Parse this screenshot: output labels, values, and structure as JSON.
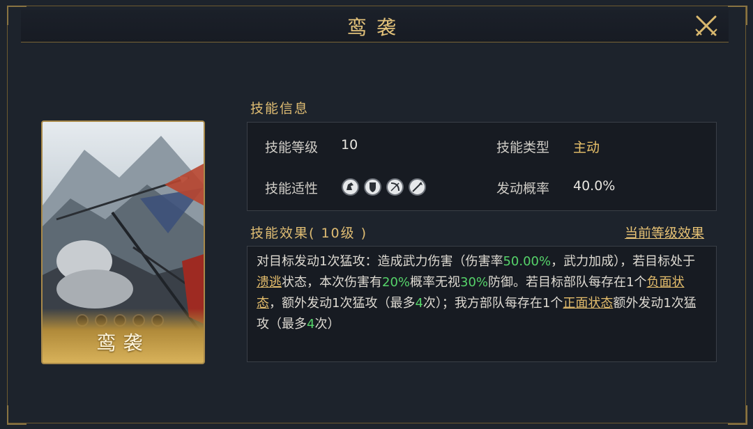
{
  "header": {
    "title": "鸾袭"
  },
  "card": {
    "name": "鸾袭",
    "level_dots": 5
  },
  "info": {
    "section_title": "技能信息",
    "level_label": "技能等级",
    "level_value": "10",
    "type_label": "技能类型",
    "type_value": "主动",
    "affinity_label": "技能适性",
    "affinity_icons": [
      "cavalry-icon",
      "shield-icon",
      "bow-icon",
      "spear-icon"
    ],
    "chance_label": "发动概率",
    "chance_value": "40.0%"
  },
  "effect": {
    "section_title": "技能效果( 10级 )",
    "current_level_link": "当前等级效果",
    "description": [
      {
        "t": "对目标发动1次猛攻：造成武力伤害（伤害率"
      },
      {
        "t": "50.00%",
        "s": "g"
      },
      {
        "t": "，武力加成），若目标处于"
      },
      {
        "t": "溃逃",
        "s": "u"
      },
      {
        "t": "状态，本次伤害有"
      },
      {
        "t": "20%",
        "s": "g"
      },
      {
        "t": "概率无视"
      },
      {
        "t": "30%",
        "s": "g"
      },
      {
        "t": "防御。若目标部队每存在1个"
      },
      {
        "t": "负面状态",
        "s": "u"
      },
      {
        "t": "，额外发动1次猛攻（最多"
      },
      {
        "t": "4",
        "s": "g"
      },
      {
        "t": "次）；我方部队每存在1个"
      },
      {
        "t": "正面状态",
        "s": "u"
      },
      {
        "t": "额外发动1次猛攻（最多"
      },
      {
        "t": "4",
        "s": "g"
      },
      {
        "t": "次）"
      }
    ]
  },
  "colors": {
    "gold": "#e0bd73",
    "highlight_green": "#56d36a",
    "background": "#1d232c"
  }
}
